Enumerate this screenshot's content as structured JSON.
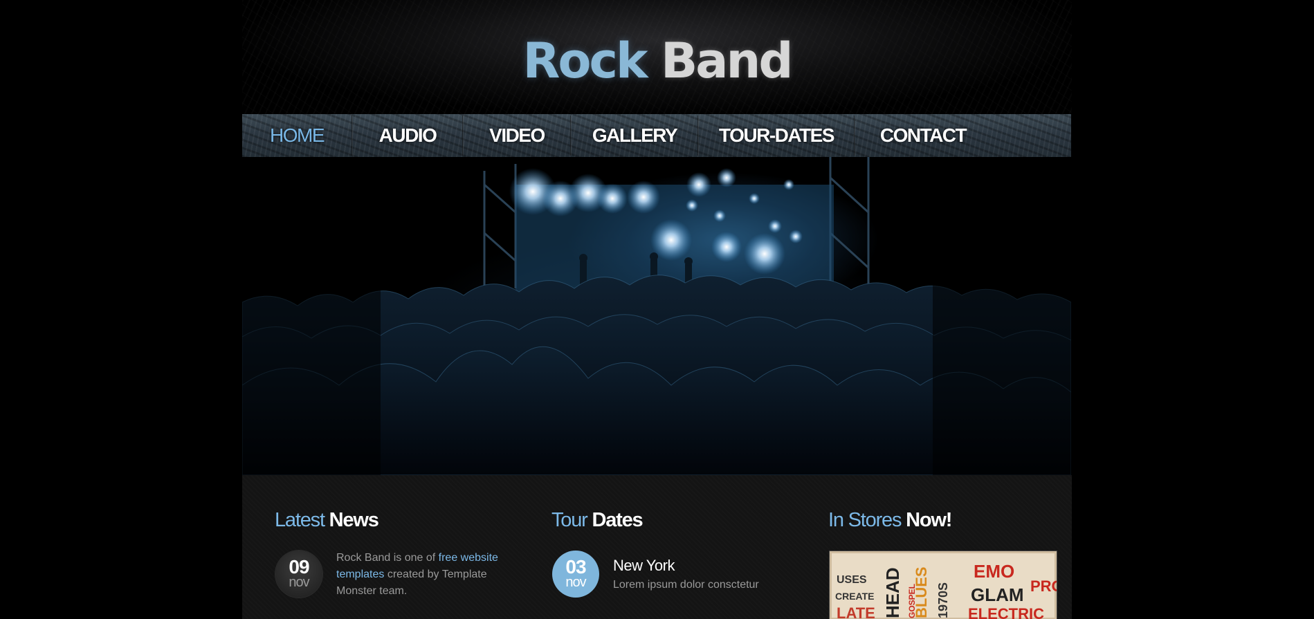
{
  "logo": {
    "word1": "Rock",
    "word2": "Band"
  },
  "nav": {
    "items": [
      {
        "label": "HOME",
        "active": true
      },
      {
        "label": "AUDIO",
        "active": false
      },
      {
        "label": "VIDEO",
        "active": false
      },
      {
        "label": "GALLERY",
        "active": false
      },
      {
        "label": "TOUR-DATES",
        "active": false
      },
      {
        "label": "CONTACT",
        "active": false
      }
    ]
  },
  "columns": {
    "news": {
      "title_a": "Latest",
      "title_b": "News",
      "date_day": "09",
      "date_month": "nov",
      "text_pre": "Rock Band is one of ",
      "text_link": "free website templates",
      "text_post": " created by Template Monster team."
    },
    "tour": {
      "title_a": "Tour",
      "title_b": "Dates",
      "date_day": "03",
      "date_month": "nov",
      "city": "New York",
      "desc": "Lorem ipsum dolor consctetur"
    },
    "stores": {
      "title_a": "In Stores",
      "title_b": "Now!",
      "image_words": [
        "USES",
        "CREATE",
        "LATE",
        "HEAD",
        "BLUES",
        "1970S",
        "EMO",
        "GLAM",
        "PRO",
        "ELECTRIC",
        "GOSPEL"
      ]
    }
  },
  "colors": {
    "accent_blue": "#7cb9e8",
    "background": "#000000",
    "panel": "#141414",
    "muted_text": "#9a9a9a"
  }
}
